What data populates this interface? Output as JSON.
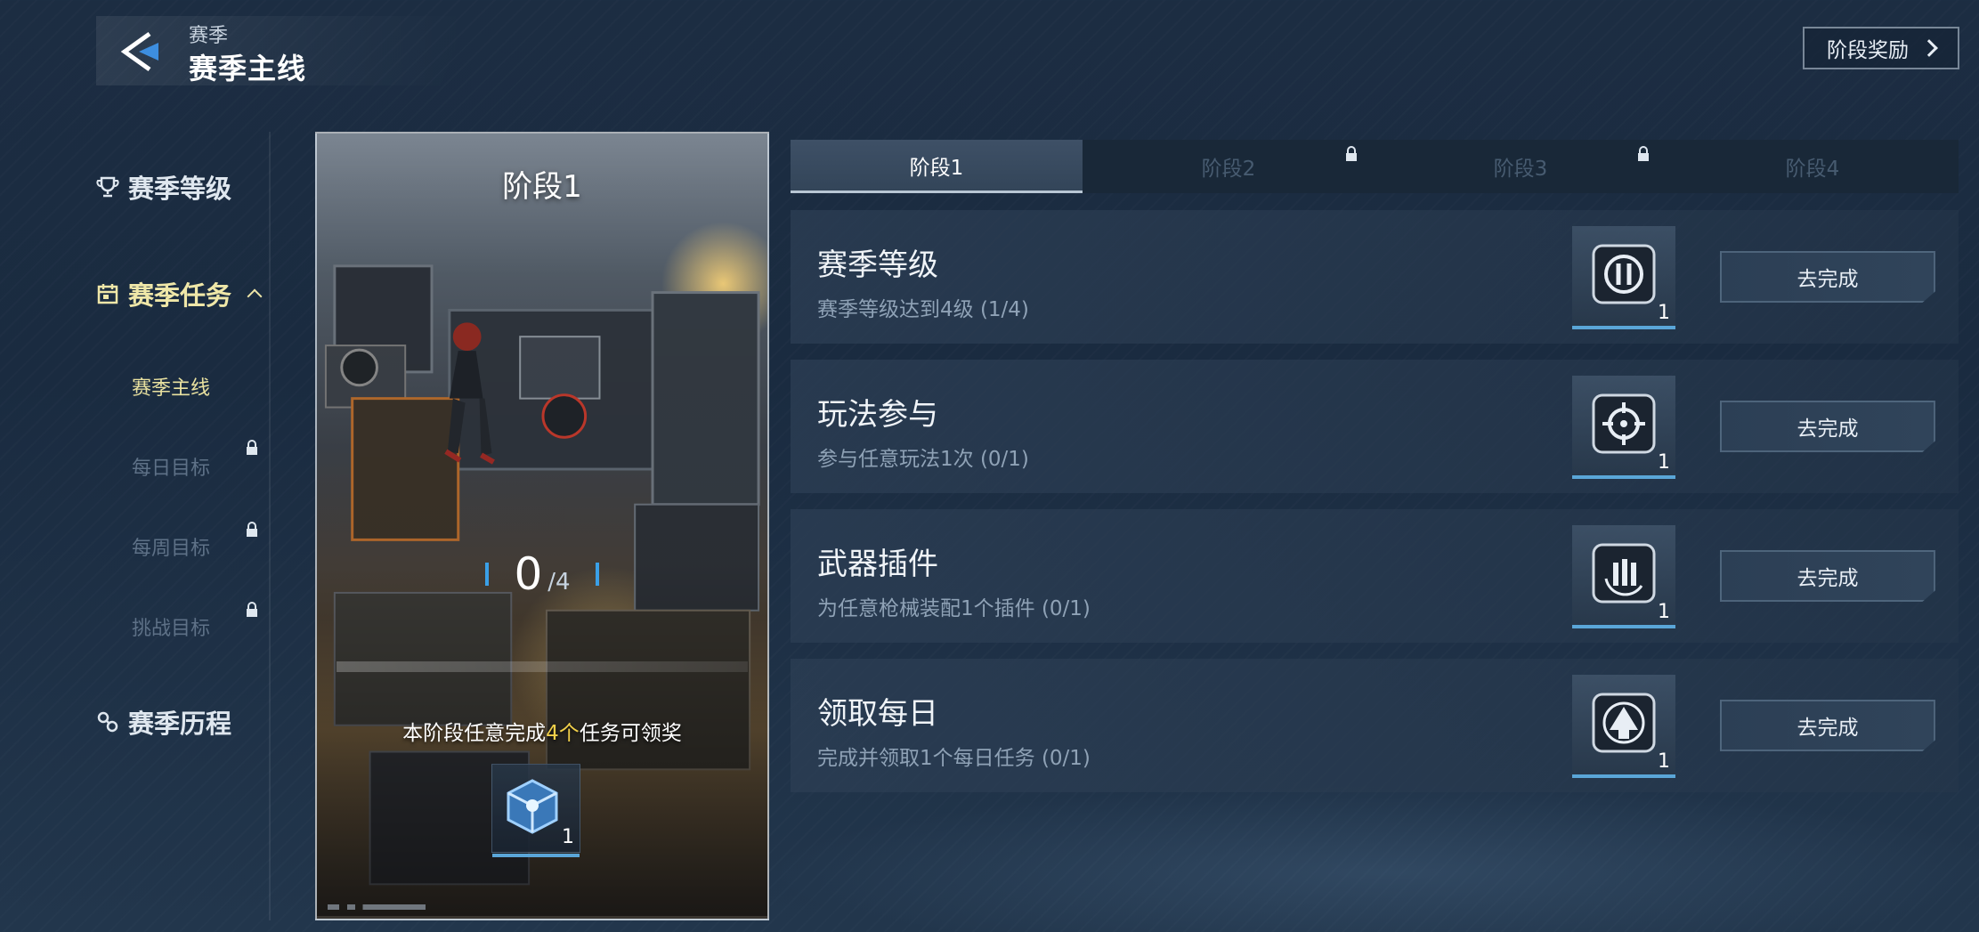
{
  "header": {
    "subtitle": "赛季",
    "title": "赛季主线",
    "stage_reward_label": "阶段奖励"
  },
  "sidebar": {
    "items": [
      {
        "label": "赛季等级",
        "icon": "trophy-icon"
      },
      {
        "label": "赛季任务",
        "icon": "calendar-icon"
      },
      {
        "label": "赛季历程",
        "icon": "journey-icon"
      }
    ],
    "sub_items": [
      {
        "label": "赛季主线",
        "locked": false
      },
      {
        "label": "每日目标",
        "locked": true
      },
      {
        "label": "每周目标",
        "locked": true
      },
      {
        "label": "挑战目标",
        "locked": true
      }
    ]
  },
  "stage_card": {
    "title": "阶段1",
    "progress_current": "0",
    "progress_total": "/4",
    "desc_prefix": "本阶段任意完成",
    "desc_highlight": "4个",
    "desc_suffix": "任务可领奖",
    "reward_count": "1"
  },
  "tabs": [
    {
      "label": "阶段1",
      "locked": false
    },
    {
      "label": "阶段2",
      "locked": true
    },
    {
      "label": "阶段3",
      "locked": true
    },
    {
      "label": "阶段4",
      "locked": false
    }
  ],
  "tasks": [
    {
      "title": "赛季等级",
      "subtitle": "赛季等级达到4级 (1/4)",
      "reward_count": "1",
      "button": "去完成",
      "reward_icon": "shield-emblem-icon"
    },
    {
      "title": "玩法参与",
      "subtitle": "参与任意玩法1次 (0/1)",
      "reward_count": "1",
      "button": "去完成",
      "reward_icon": "crosshair-icon"
    },
    {
      "title": "武器插件",
      "subtitle": "为任意枪械装配1个插件 (0/1)",
      "reward_count": "1",
      "button": "去完成",
      "reward_icon": "ammo-icon"
    },
    {
      "title": "领取每日",
      "subtitle": "完成并领取1个每日任务 (0/1)",
      "reward_count": "1",
      "button": "去完成",
      "reward_icon": "upgrade-arrow-icon"
    }
  ],
  "colors": {
    "accent_yellow": "#f2d04a",
    "active_nav": "#efe7a8",
    "progress_blue": "#3aa0e8"
  }
}
